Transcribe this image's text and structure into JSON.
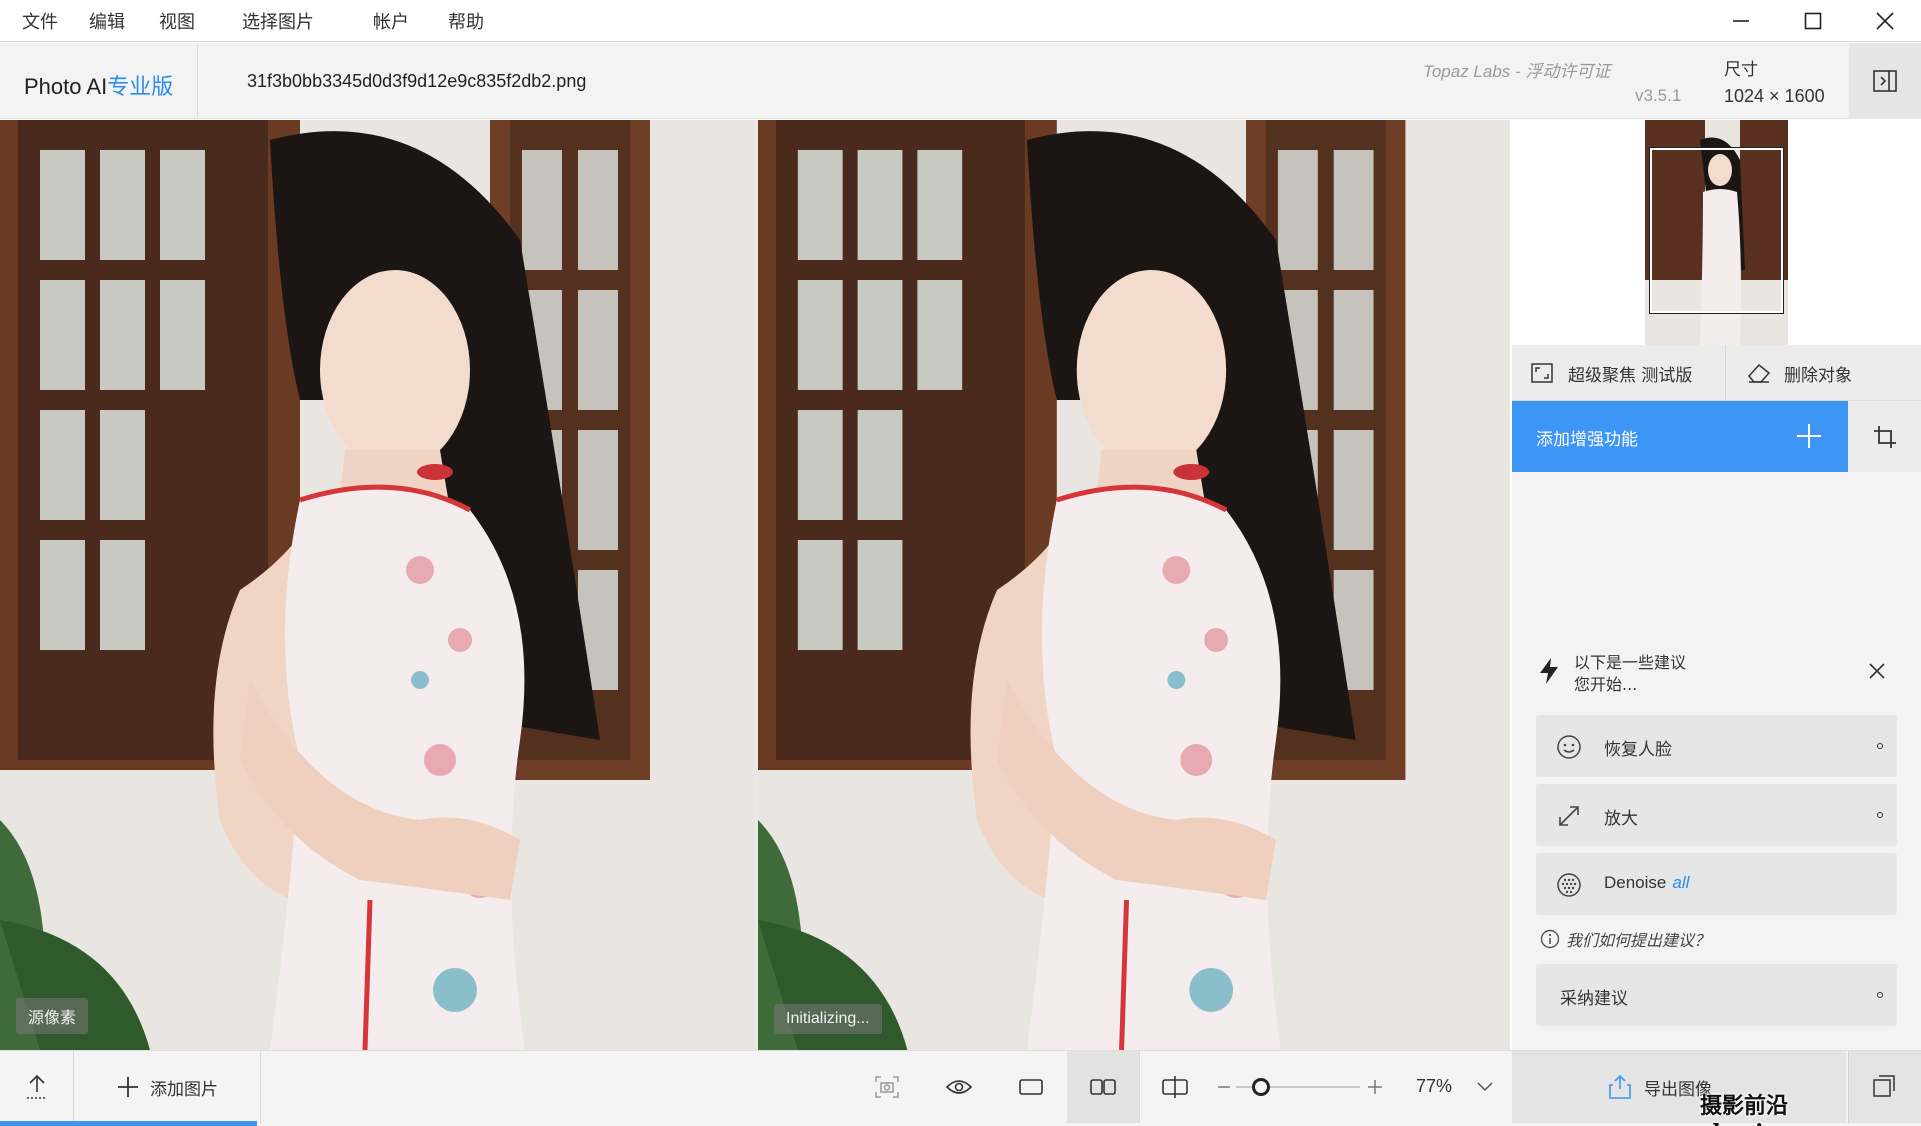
{
  "menu": {
    "items": [
      {
        "label": "文件",
        "id": "file"
      },
      {
        "label": "编辑",
        "id": "edit"
      },
      {
        "label": "视图",
        "id": "view"
      },
      {
        "label": "选择图片",
        "id": "select-image"
      },
      {
        "label": "帐户",
        "id": "account"
      },
      {
        "label": "帮助",
        "id": "help"
      }
    ]
  },
  "header": {
    "brand_main": "Photo AI",
    "brand_edition": "专业版",
    "filename": "31f3b0bb3345d0d3f9d12e9c835f2db2.png",
    "license": "Topaz Labs - 浮动许可证",
    "version": "v3.5.1",
    "size_label": "尺寸",
    "size_value": "1024 × 1600"
  },
  "panes": {
    "left_badge": "源像素",
    "right_badge": "Initializing..."
  },
  "side": {
    "superfocus_label": "超级聚焦 测试版",
    "remove_object_label": "删除对象",
    "add_enhancement_label": "添加增强功能",
    "suggestions_title_line1": "以下是一些建议",
    "suggestions_title_line2": "您开始...",
    "suggestions": [
      {
        "label": "恢复人脸",
        "tag": "",
        "icon": "face-icon"
      },
      {
        "label": "放大",
        "tag": "",
        "icon": "upscale-icon"
      },
      {
        "label": "Denoise",
        "tag": "all",
        "icon": "denoise-icon"
      }
    ],
    "how_label": "我们如何提出建议？",
    "accept_label": "采纳建议"
  },
  "bottom": {
    "add_image_label": "添加图片",
    "zoom_value": "77%",
    "zoom_fraction": 0.2,
    "export_label": "导出图像",
    "progress_fraction": 0.134
  },
  "watermark": "摄影前沿 sheyingzyz.com",
  "colors": {
    "accent": "#3d95f5",
    "brand_edition": "#2d8cf0"
  }
}
